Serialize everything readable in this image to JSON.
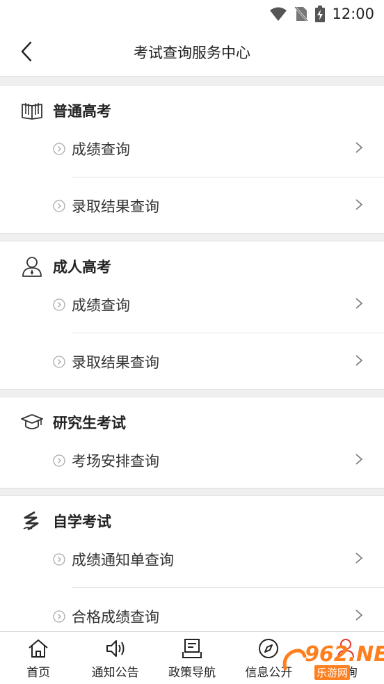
{
  "status_bar": {
    "time": "12:00"
  },
  "header": {
    "title": "考试查询服务中心"
  },
  "sections": [
    {
      "title": "普通高考",
      "icon": "open-book-icon",
      "items": [
        {
          "label": "成绩查询"
        },
        {
          "label": "录取结果查询"
        }
      ]
    },
    {
      "title": "成人高考",
      "icon": "person-icon",
      "items": [
        {
          "label": "成绩查询"
        },
        {
          "label": "录取结果查询"
        }
      ]
    },
    {
      "title": "研究生考试",
      "icon": "graduation-cap-icon",
      "items": [
        {
          "label": "考场安排查询"
        }
      ]
    },
    {
      "title": "自学考试",
      "icon": "self-study-logo-icon",
      "items": [
        {
          "label": "成绩通知单查询"
        },
        {
          "label": "合格成绩查询"
        }
      ]
    }
  ],
  "tabbar": [
    {
      "label": "首页",
      "icon": "home-icon"
    },
    {
      "label": "通知公告",
      "icon": "speaker-icon"
    },
    {
      "label": "政策导航",
      "icon": "document-icon"
    },
    {
      "label": "信息公开",
      "icon": "compass-icon"
    },
    {
      "label": "查询",
      "icon": "search-person-icon"
    }
  ],
  "watermark": {
    "brand": "962.NET",
    "sub": "乐游网"
  },
  "colors": {
    "accent": "#ff7f1e",
    "text": "#222222",
    "muted": "#999999",
    "background": "#efefef"
  }
}
